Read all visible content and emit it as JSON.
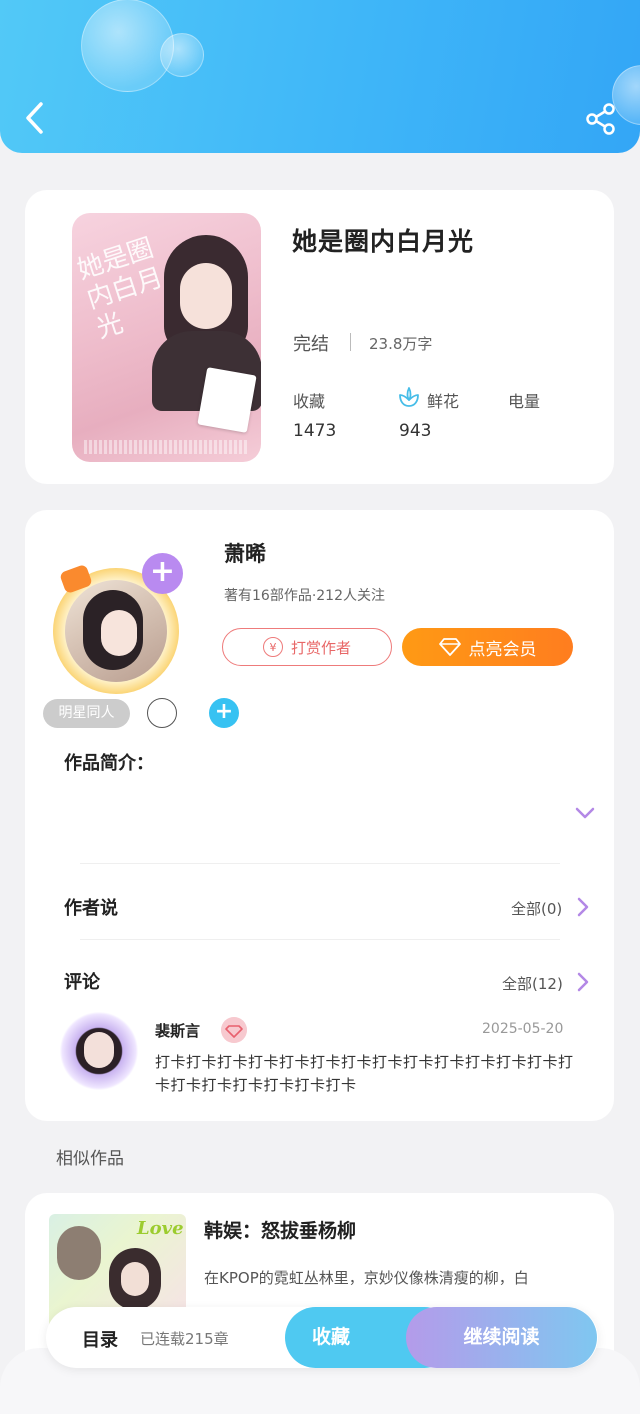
{
  "book": {
    "title": "她是圈内白月光",
    "cover_title": "她是圈内白月光",
    "status": "完结",
    "word_count": "23.8万字",
    "stats": {
      "favorites_label": "收藏",
      "favorites_value": "1473",
      "flowers_label": "鲜花",
      "flowers_value": "943",
      "power_label": "电量"
    }
  },
  "author": {
    "name": "萧晞",
    "info": "著有16部作品·212人关注",
    "tip_label": "打赏作者",
    "vip_label": "点亮会员",
    "tag": "明星同人"
  },
  "intro": {
    "label": "作品简介："
  },
  "author_note": {
    "label": "作者说",
    "more": "全部(0)"
  },
  "comments": {
    "label": "评论",
    "more": "全部(12)",
    "items": [
      {
        "user": "裴斯言",
        "date": "2025-05-20",
        "text": "打卡打卡打卡打卡打卡打卡打卡打卡打卡打卡打卡打卡打卡打卡打卡打卡打卡打卡打卡打卡"
      }
    ]
  },
  "similar": {
    "label": "相似作品",
    "items": [
      {
        "title": "韩娱：怒拔垂杨柳",
        "desc": "在KPOP的霓虹丛林里，京妙仪像株清瘦的柳，白"
      }
    ]
  },
  "bottom_bar": {
    "toc_label": "目录",
    "chapters": "已连载215章",
    "favorite_label": "收藏",
    "read_label": "继续阅读"
  },
  "colors": {
    "header": "#3fb6f8",
    "vip": "#ff8a1a",
    "tip": "#e86767",
    "favorite_button": "#4fc9f1",
    "follow_button": "#b98af0",
    "tag_add": "#37c2f2"
  },
  "icons": [
    "back-arrow-icon",
    "share-icon",
    "flower-icon",
    "plus-icon",
    "yen-icon",
    "diamond-icon",
    "chevron-down-icon",
    "chevron-right-icon"
  ]
}
